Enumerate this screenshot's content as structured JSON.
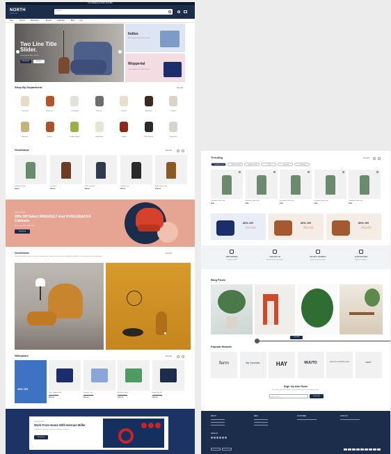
{
  "topbar": {
    "text": "Free Shipping on Orders Over $50"
  },
  "header": {
    "logo": "NORTH",
    "tagline": "FURNITURE",
    "search_placeholder": "Search",
    "nav": [
      "New",
      "Rooms",
      "Bestsellers",
      "Brands",
      "Lookbook",
      "Blog",
      "Sale"
    ]
  },
  "hero": {
    "title": "Two Line Title Slider.",
    "subtitle": "Lorem ipsum dolor sit amet",
    "btn1": "Shop Now",
    "btn2": "Explore"
  },
  "promo1": {
    "title": "Indios",
    "text": "What to expect and why it's a trend"
  },
  "promo2": {
    "title": "Wuppertal",
    "text": "Color changes & fine finish furniture"
  },
  "departments": {
    "title": "Shop By Department",
    "view_all": "View All",
    "items": [
      "Table lamp",
      "Armchairs",
      "Chair dining",
      "Benches",
      "Cushions",
      "Nightstand",
      "Pendants",
      "Armchairs",
      "Plug-ins",
      "Outdoor lounge",
      "Lampshades",
      "Candles",
      "Vases & bowls",
      "Dining sets"
    ]
  },
  "goodshow1": {
    "title": "Goodshow",
    "view_all": "View All",
    "products": [
      {
        "name": "Goodshow Lamp",
        "price": "$98.00"
      },
      {
        "name": "Lamp Arco",
        "price": "$145.00"
      },
      {
        "name": "Task Lamp Dark",
        "price": "$89.00"
      },
      {
        "name": "Cylinder Lamp",
        "price": "$120.00"
      },
      {
        "name": "Amber Glass Lamp",
        "price": "$160.00"
      }
    ]
  },
  "banner": {
    "small": "LIMITED OFFER",
    "title": "20% Off Select RINGHULT And KUNGSBACKA Cabinets",
    "text": "Refresh your kitchen for less.",
    "btn": "Shop Now"
  },
  "goodshow2": {
    "title": "Goodshow",
    "view_all": "View All",
    "text": "Lorem ipsum dolor sit amet, consectetur adipiscing elit. Vivamus lacinia odio vitae vestibulum vestibulum. Cras venenatis euismod malesuada."
  },
  "wareplace": {
    "title": "Wareplace",
    "view_all": "View All",
    "feature": "40% Off",
    "products": [
      {
        "name": "Desk Organizer Blue",
        "price": "$275.00"
      },
      {
        "name": "Organizer Tray",
        "price": "$275.00"
      },
      {
        "name": "File Sorter Green",
        "price": "$375.00"
      },
      {
        "name": "Binder Clips Set",
        "price": "$275.00"
      }
    ]
  },
  "herman": {
    "small": "NEW ARRIVALS",
    "title": "Work From Home With Herman Miller",
    "text": "Designed for comfort, built for focus and long work days.",
    "btn": "Shop Now"
  },
  "trending": {
    "title": "Trending",
    "view_all": "View All",
    "chips": [
      "Marketing & Office",
      "Chairs & Seating",
      "Desk Accessories",
      "Lamps",
      "Table Lamps",
      "Organizers"
    ],
    "products": [
      {
        "name": "Goodshow Table Lamp",
        "price": "$149"
      },
      {
        "name": "Goodshow Table Lamp",
        "price": "$149"
      },
      {
        "name": "Goodshow Table Lamp",
        "price": "$149"
      },
      {
        "name": "Goodshow Table Lamp",
        "price": "$149"
      },
      {
        "name": "Goodshow Table Lamp",
        "price": "$149"
      }
    ]
  },
  "offers": [
    {
      "pct": "30% Off",
      "word": "North"
    },
    {
      "pct": "20% Off",
      "word": "North"
    },
    {
      "pct": "60% Off",
      "word": "North"
    }
  ],
  "features": [
    {
      "title": "FREE SHIPPING",
      "text": "On orders over $50"
    },
    {
      "title": "CHAT WITH US",
      "text": "We offer 24-hour chat support"
    },
    {
      "title": "SECURITY PAYMENTS",
      "text": "100% protected transactions"
    },
    {
      "title": "14-DAY RETURNS",
      "text": "Shop with confidence"
    }
  ],
  "blog": {
    "title": "Blog Posts",
    "btn": "View All"
  },
  "brands": {
    "title": "Popular Brands",
    "items": [
      "ferm",
      "by Lassen",
      "HAY",
      "MUUTO",
      "BRUUNS COPENHAGEN",
      "KEPP"
    ]
  },
  "newsletter": {
    "title": "Sign Up And Save",
    "text": "Subscribe to get special offers, free giveaways, and once-in-a-lifetime deals.",
    "placeholder": "Enter email",
    "btn": "Subscribe"
  },
  "footer": {
    "cols": [
      "ABOUT",
      "HELP",
      "CUSTOMER",
      "CONTACT"
    ],
    "follow": "Follow Us"
  },
  "colors": {
    "navy": "#1c2d4b",
    "salmon": "#e6a592",
    "grey": "#ececec"
  }
}
